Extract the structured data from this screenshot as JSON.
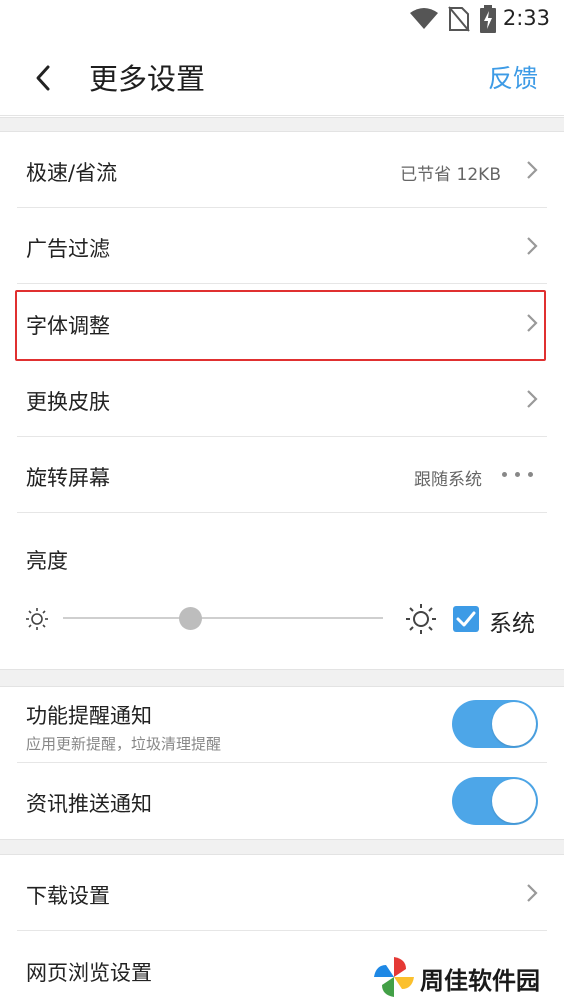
{
  "status_bar": {
    "time": "2:33",
    "icons": [
      "wifi-icon",
      "no-sim-icon",
      "battery-charging-icon"
    ]
  },
  "header": {
    "title": "更多设置",
    "feedback": "反馈",
    "back_icon": "chevron-left-icon"
  },
  "settings": {
    "speed_saving": {
      "label": "极速/省流",
      "value": "已节省 12KB"
    },
    "ad_filter": {
      "label": "广告过滤"
    },
    "font_adjust": {
      "label": "字体调整"
    },
    "change_skin": {
      "label": "更换皮肤"
    },
    "rotate_screen": {
      "label": "旋转屏幕",
      "value": "跟随系统"
    },
    "brightness": {
      "label": "亮度",
      "level": 0.36,
      "system_label": "系统",
      "system_checked": true
    }
  },
  "notifications": {
    "feature_reminder": {
      "label": "功能提醒通知",
      "sublabel": "应用更新提醒，垃圾清理提醒",
      "enabled": true
    },
    "news_push": {
      "label": "资讯推送通知",
      "enabled": true
    }
  },
  "more": {
    "download": {
      "label": "下载设置"
    },
    "browse": {
      "label": "网页浏览设置"
    }
  },
  "watermark": {
    "text": "周佳软件园"
  },
  "colors": {
    "accent": "#3d9be6",
    "toggle": "#4da6e8",
    "highlight": "#e03030"
  }
}
